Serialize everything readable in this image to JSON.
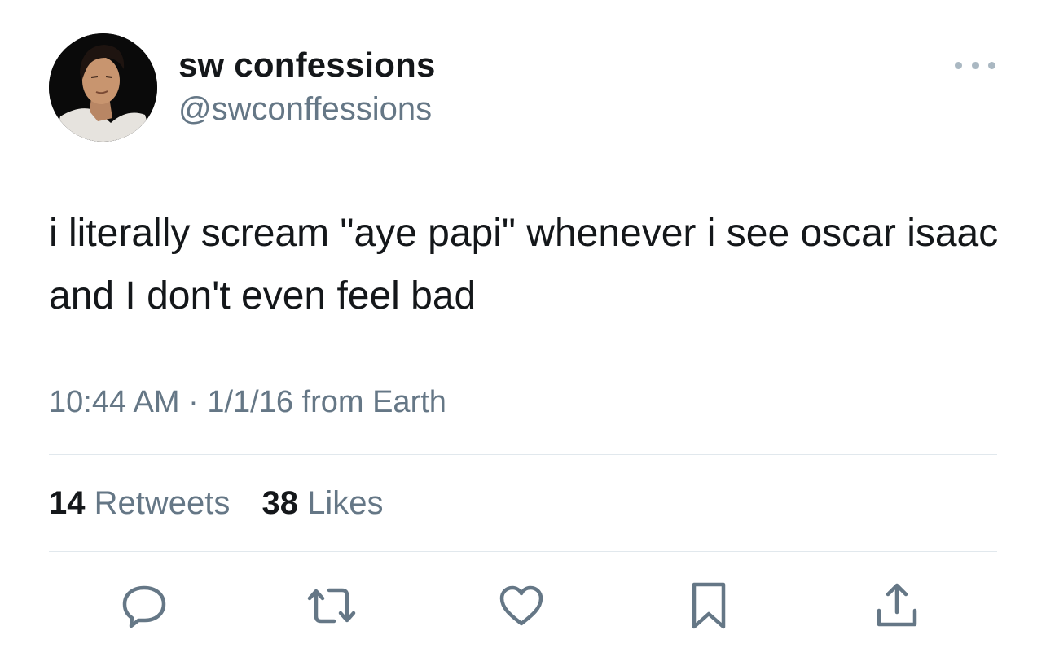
{
  "user": {
    "display_name": "sw confessions",
    "handle": "@swconffessions",
    "avatar_icon": "profile-photo"
  },
  "tweet": {
    "text": "i literally scream \"aye papi\" whenever i see oscar isaac and I don't even feel bad",
    "timestamp": "10:44 AM · 1/1/16 from Earth"
  },
  "stats": {
    "retweets_count": "14",
    "retweets_label": "Retweets",
    "likes_count": "38",
    "likes_label": "Likes"
  },
  "actions": [
    "reply-icon",
    "retweet-icon",
    "like-icon",
    "bookmark-icon",
    "share-icon"
  ],
  "colors": {
    "text_primary": "#14171a",
    "text_secondary": "#657786",
    "divider": "#e1e8ed",
    "more_dots": "#aab8c2"
  }
}
